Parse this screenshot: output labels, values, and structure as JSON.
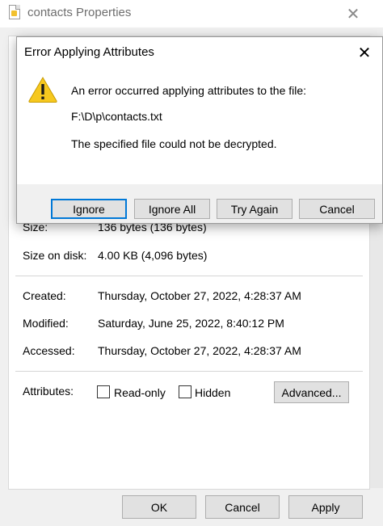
{
  "properties_window": {
    "title": "contacts Properties",
    "close_glyph": "✕",
    "rows": {
      "size_label": "Size:",
      "size_value": "136 bytes (136 bytes)",
      "size_on_disk_label": "Size on disk:",
      "size_on_disk_value": "4.00 KB (4,096 bytes)",
      "created_label": "Created:",
      "created_value": "Thursday, October 27, 2022, 4:28:37 AM",
      "modified_label": "Modified:",
      "modified_value": "Saturday, June 25, 2022, 8:40:12 PM",
      "accessed_label": "Accessed:",
      "accessed_value": "Thursday, October 27, 2022, 4:28:37 AM",
      "attributes_label": "Attributes:"
    },
    "attributes": {
      "read_only_label": "Read-only",
      "read_only_checked": false,
      "hidden_label": "Hidden",
      "hidden_checked": false,
      "advanced_label": "Advanced..."
    },
    "footer": {
      "ok_label": "OK",
      "cancel_label": "Cancel",
      "apply_label": "Apply"
    }
  },
  "error_dialog": {
    "title": "Error Applying Attributes",
    "close_glyph": "✕",
    "icon": "warning-icon",
    "message_line1": "An error occurred applying attributes to the file:",
    "file_path": "F:\\D\\p\\contacts.txt",
    "message_line2": "The specified file could not be decrypted.",
    "buttons": {
      "ignore": "Ignore",
      "ignore_all": "Ignore All",
      "try_again": "Try Again",
      "cancel": "Cancel"
    }
  },
  "colors": {
    "warning_fill": "#f6c81f",
    "default_button_border": "#0078d7"
  }
}
